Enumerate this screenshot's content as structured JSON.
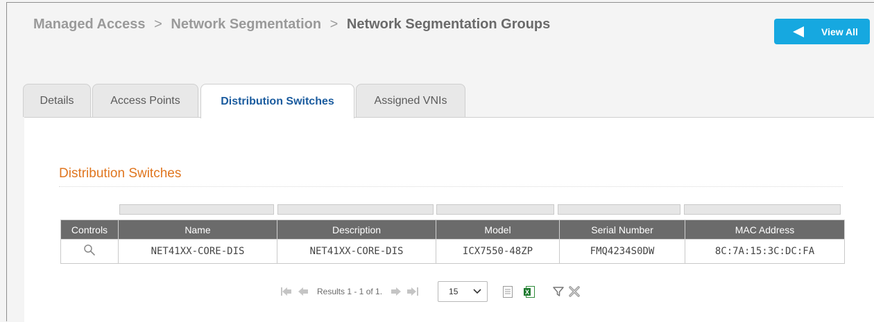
{
  "breadcrumb": {
    "items": [
      "Managed Access",
      "Network Segmentation"
    ],
    "separator": ">",
    "current": "Network Segmentation Groups"
  },
  "header": {
    "view_all_label": "View All",
    "view_all_icon": "arrow-left-icon"
  },
  "tabs": [
    {
      "label": "Details",
      "active": false
    },
    {
      "label": "Access Points",
      "active": false
    },
    {
      "label": "Distribution Switches",
      "active": true
    },
    {
      "label": "Assigned VNIs",
      "active": false
    }
  ],
  "section": {
    "title": "Distribution Switches"
  },
  "table": {
    "columns": [
      "Controls",
      "Name",
      "Description",
      "Model",
      "Serial Number",
      "MAC Address"
    ],
    "rows": [
      {
        "control_icon": "magnifier-icon",
        "name": "NET41XX-CORE-DIS",
        "description": "NET41XX-CORE-DIS",
        "model": "ICX7550-48ZP",
        "serial": "FMQ4234S0DW",
        "mac": "8C:7A:15:3C:DC:FA"
      }
    ]
  },
  "pager": {
    "results_text": "Results 1 - 1 of 1.",
    "page_size": "15",
    "icons": [
      "first-page-icon",
      "prev-page-icon",
      "next-page-icon",
      "last-page-icon",
      "document-icon",
      "excel-export-icon",
      "filter-icon",
      "clear-filter-icon"
    ]
  },
  "colors": {
    "accent_blue": "#16a8e0",
    "active_tab_text": "#1a5b9e",
    "section_title": "#e0761f",
    "header_bg": "#6b6b6b"
  }
}
